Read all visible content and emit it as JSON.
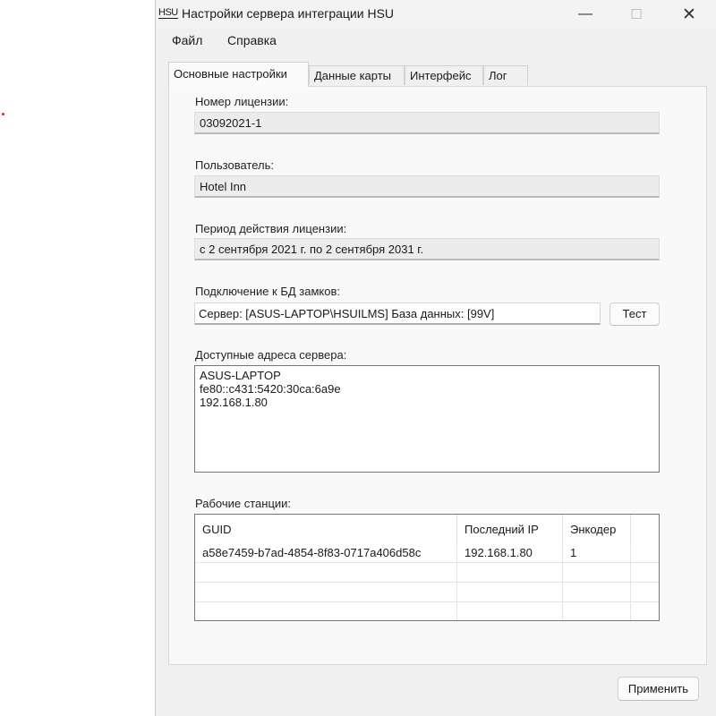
{
  "window": {
    "app_icon_label": "HSU",
    "title": "Настройки сервера интеграции HSU",
    "controls": {
      "minimize": "—",
      "maximize": "☐",
      "close": "✕"
    }
  },
  "menu": {
    "items": [
      "Файл",
      "Справка"
    ]
  },
  "tabs": [
    "Основные настройки",
    "Данные карты",
    "Интерфейс",
    "Лог"
  ],
  "main": {
    "license_number": {
      "label": "Номер лицензии:",
      "value": "03092021-1"
    },
    "user": {
      "label": "Пользователь:",
      "value": "Hotel Inn"
    },
    "validity": {
      "label": "Период действия лицензии:",
      "value": "с 2 сентября 2021 г. по 2 сентября 2031 г."
    },
    "db_connection": {
      "label": "Подключение к БД замков:",
      "value": "Сервер: [ASUS-LAPTOP\\HSUILMS] База данных: [99V]",
      "test_button": "Тест"
    },
    "server_addresses": {
      "label": "Доступные адреса сервера:",
      "lines": [
        "ASUS-LAPTOP",
        "fe80::c431:5420:30ca:6a9e",
        "192.168.1.80"
      ]
    },
    "workstations": {
      "label": "Рабочие станции:",
      "columns": [
        "GUID",
        "Последний IP",
        "Энкодер"
      ],
      "rows": [
        [
          "a58e7459-b7ad-4854-8f83-0717a406d58c",
          "192.168.1.80",
          "1"
        ]
      ]
    }
  },
  "footer": {
    "apply_button": "Применить"
  }
}
